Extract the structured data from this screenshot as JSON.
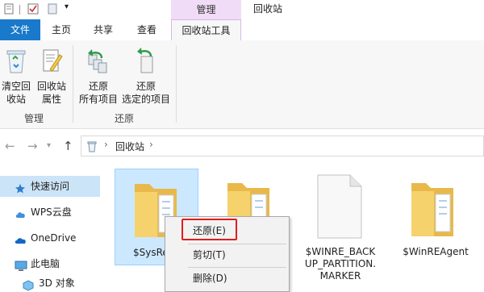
{
  "quick_access_toolbar": {
    "pin_icon": "properties-icon",
    "check_icon": "check-icon",
    "doc_icon": "new-folder-icon",
    "dropdown_icon": "chevron-down-icon"
  },
  "title_bar": {
    "context_header": "管理",
    "window_title": "回收站"
  },
  "tabs": {
    "file": "文件",
    "home": "主页",
    "share": "共享",
    "view": "查看",
    "recycle_tools": "回收站工具"
  },
  "ribbon": {
    "manage_group": {
      "label": "管理",
      "empty_recycle_bin": {
        "line1": "清空回",
        "line2": "收站"
      },
      "recycle_properties": {
        "line1": "回收站",
        "line2": "属性"
      }
    },
    "restore_group": {
      "label": "还原",
      "restore_all": {
        "line1": "还原",
        "line2": "所有项目"
      },
      "restore_selected": {
        "line1": "还原",
        "line2": "选定的项目"
      }
    }
  },
  "address_bar": {
    "path": "回收站"
  },
  "nav_pane": {
    "items": [
      {
        "label": "快速访问",
        "icon": "star-icon"
      },
      {
        "label": "WPS云盘",
        "icon": "cloud-icon"
      },
      {
        "label": "OneDrive",
        "icon": "onedrive-icon"
      },
      {
        "label": "此电脑",
        "icon": "computer-icon"
      },
      {
        "label": "3D 对象",
        "icon": "3d-objects-icon"
      }
    ]
  },
  "files": [
    {
      "name": "$SysRe",
      "type": "folder"
    },
    {
      "name": "",
      "type": "folder"
    },
    {
      "name": "$WINRE_BACKUP_PARTITION.MARKER",
      "line1": "$WINRE_BACK",
      "line2": "UP_PARTITION.",
      "line3": "MARKER",
      "type": "file"
    },
    {
      "name": "$WinREAgent",
      "type": "folder"
    }
  ],
  "context_menu": {
    "restore": "还原(E)",
    "cut": "剪切(T)",
    "delete": "删除(D)"
  },
  "colors": {
    "file_tab": "#1979ca",
    "context_header": "#f1dcf7",
    "selection": "#cce8ff",
    "highlight_box": "#e11d1d"
  }
}
